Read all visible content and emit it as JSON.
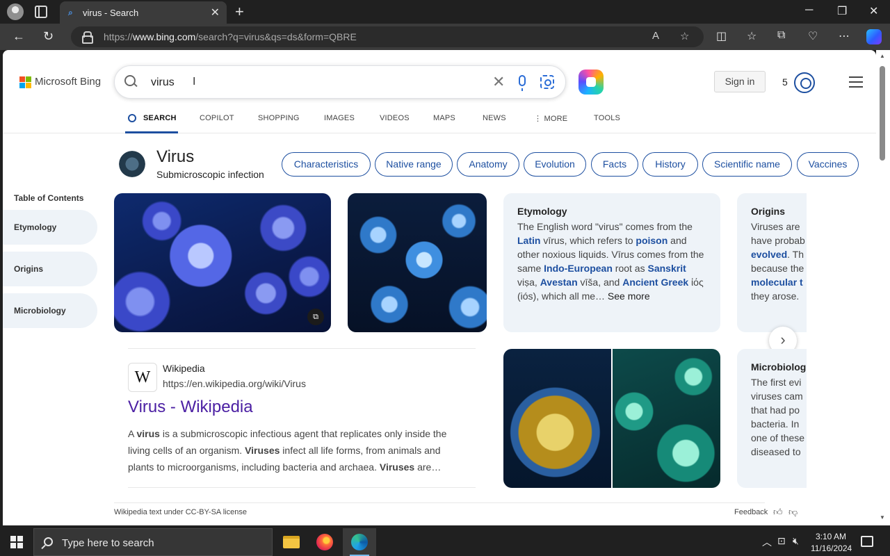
{
  "browser": {
    "tab_title": "virus - Search",
    "url_prefix": "https://",
    "url_host": "www.bing.com",
    "url_path": "/search?q=virus&qs=ds&form=QBRE"
  },
  "header": {
    "logo_text": "Microsoft Bing",
    "search_value": "virus",
    "sign_in": "Sign in",
    "rewards_count": "5"
  },
  "nav": {
    "tabs": [
      "SEARCH",
      "COPILOT",
      "SHOPPING",
      "IMAGES",
      "VIDEOS",
      "MAPS",
      "NEWS",
      "MORE",
      "TOOLS"
    ]
  },
  "entity": {
    "title": "Virus",
    "subtitle": "Submicroscopic infection",
    "pills": [
      "Characteristics",
      "Native range",
      "Anatomy",
      "Evolution",
      "Facts",
      "History",
      "Scientific name",
      "Vaccines"
    ]
  },
  "toc": {
    "title": "Table of Contents",
    "items": [
      "Etymology",
      "Origins",
      "Microbiology"
    ]
  },
  "cards": {
    "etymology": {
      "title": "Etymology",
      "t1": "The English word \"virus\" comes from the ",
      "l1": "Latin",
      "t2": " vīrus, which refers to ",
      "l2": "poison",
      "t3": " and other noxious liquids. Vīrus comes from the same ",
      "l3": "Indo-European",
      "t4": " root as ",
      "l4": "Sanskrit",
      "t5": " viṣa, ",
      "l5": "Avestan",
      "t6": " vīša, and ",
      "l6": "Ancient Greek",
      "t7": " ἰός (iós), which all me… ",
      "more": "See more"
    },
    "origins": {
      "title": "Origins",
      "t1": "Viruses are",
      "t2": "have probab",
      "l1": "evolved",
      "t3": ". Th",
      "t4": "because the",
      "l2": "molecular t",
      "t5": "they arose."
    },
    "microbiology": {
      "title": "Microbiolog",
      "lines": [
        "The first evi",
        "viruses cam",
        "that had po",
        "bacteria. In",
        "one of these",
        "diseased to"
      ]
    }
  },
  "result": {
    "site": "Wikipedia",
    "url": "https://en.wikipedia.org/wiki/Virus",
    "title": "Virus - Wikipedia",
    "s1": "A ",
    "b1": "virus",
    "s2": " is a submicroscopic infectious agent that replicates only inside the living cells of an organism. ",
    "b2": "Viruses",
    "s3": " infect all life forms, from animals and plants to microorganisms, including bacteria and archaea. ",
    "b3": "Viruses",
    "s4": " are…"
  },
  "footer": {
    "license": "Wikipedia text under CC-BY-SA license",
    "feedback": "Feedback"
  },
  "taskbar": {
    "search_placeholder": "Type here to search",
    "time": "3:10 AM",
    "date": "11/16/2024"
  }
}
